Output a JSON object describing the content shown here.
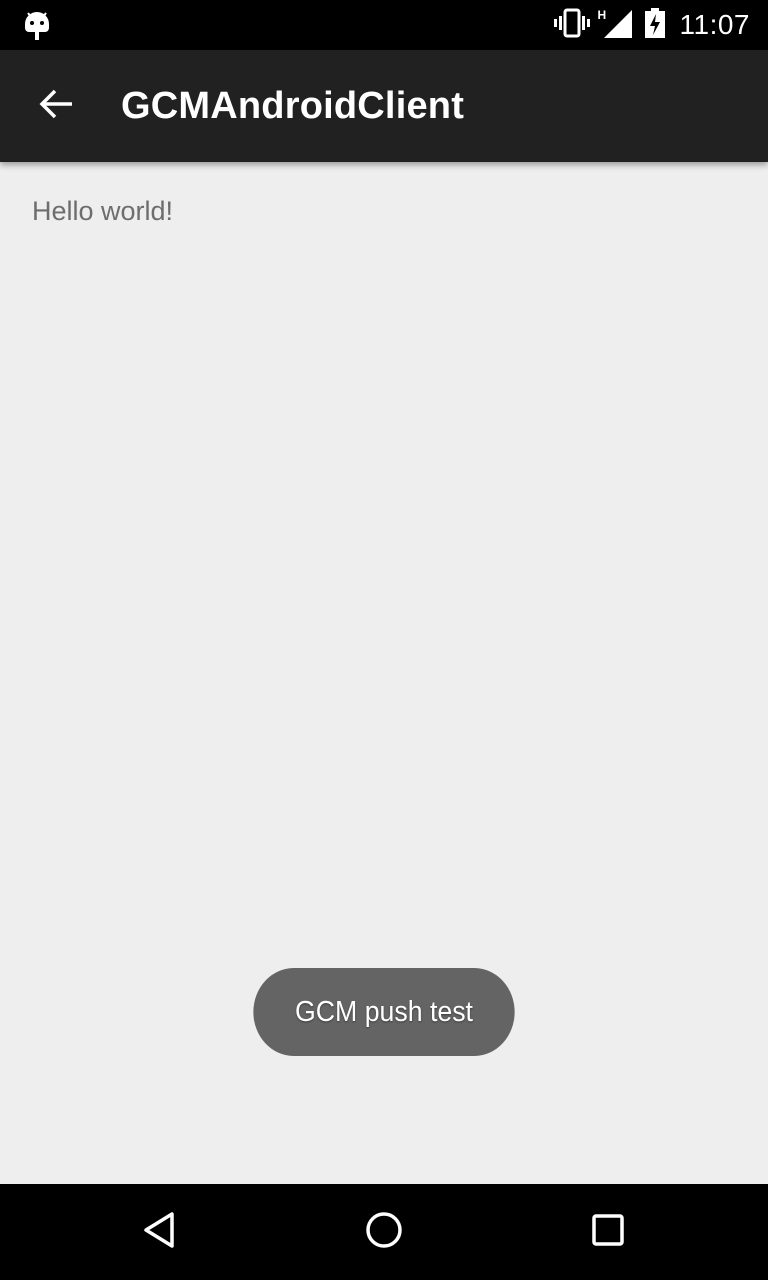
{
  "status_bar": {
    "time": "11:07",
    "network_type": "H",
    "icons": [
      "android-debug-icon",
      "vibrate-icon",
      "signal-icon",
      "battery-charging-icon"
    ]
  },
  "app_bar": {
    "title": "GCMAndroidClient",
    "back_icon": "arrow-back-icon"
  },
  "content": {
    "message": "Hello world!"
  },
  "toast": {
    "text": "GCM push test"
  },
  "nav_bar": {
    "icons": [
      "back-triangle-icon",
      "home-circle-icon",
      "recents-square-icon"
    ]
  },
  "colors": {
    "background": "#eeeeee",
    "app_bar": "#212121",
    "toast": "#646464",
    "system_bars": "#000000"
  }
}
